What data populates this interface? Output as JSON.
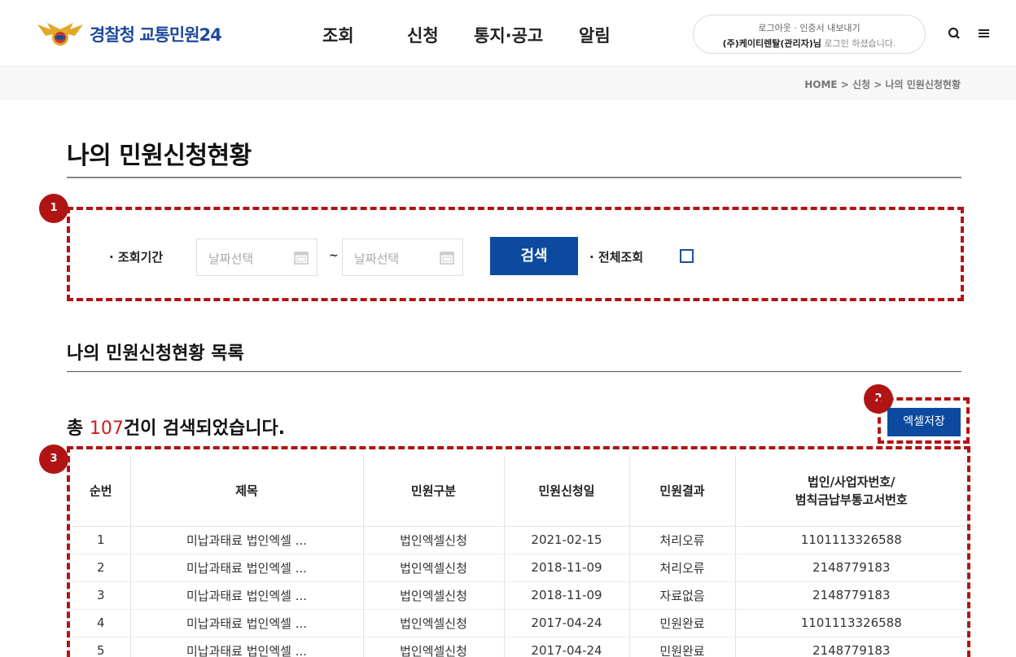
{
  "header": {
    "logo_text": "경찰청 교통민원24",
    "nav": [
      "조회",
      "신청",
      "통지·공고",
      "알림"
    ],
    "login": {
      "line1": "로그아웃 · 인증서 내보내기",
      "user": "(주)케이티렌탈(관리자)님",
      "suffix": "로그인 하셨습니다."
    }
  },
  "breadcrumb": "HOME > 신청 > 나의 민원신청현황",
  "page_title": "나의 민원신청현황",
  "search": {
    "period_label": "· 조회기간",
    "start_placeholder": "날짜선택",
    "tilde": "~",
    "end_placeholder": "날짜선택",
    "search_button": "검색",
    "all_label": "· 전체조회"
  },
  "badges": [
    "1",
    "2",
    "3"
  ],
  "list": {
    "title": "나의 민원신청현황 목록",
    "count_prefix": "총 ",
    "count": "107",
    "count_suffix": "건이 검색되었습니다.",
    "excel_button": "엑셀저장"
  },
  "table": {
    "headers": [
      "순번",
      "제목",
      "민원구분",
      "민원신청일",
      "민원결과",
      "법인/사업자번호/",
      "범칙금납부통고서번호"
    ],
    "rows": [
      [
        "1",
        "미납과태료 법인엑셀 ...",
        "법인엑셀신청",
        "2021-02-15",
        "처리오류",
        "1101113326588"
      ],
      [
        "2",
        "미납과태료 법인엑셀 ...",
        "법인엑셀신청",
        "2018-11-09",
        "처리오류",
        "2148779183"
      ],
      [
        "3",
        "미납과태료 법인엑셀 ...",
        "법인엑셀신청",
        "2018-11-09",
        "자료없음",
        "2148779183"
      ],
      [
        "4",
        "미납과태료 법인엑셀 ...",
        "법인엑셀신청",
        "2017-04-24",
        "민원완료",
        "1101113326588"
      ],
      [
        "5",
        "미납과태료 법인엑셀 ...",
        "법인엑셀신청",
        "2017-04-24",
        "민원완료",
        "2148779183"
      ]
    ]
  },
  "colors": {
    "brand": "#1d4a9b",
    "button": "#0b4a9e",
    "annotation": "#b01414",
    "count": "#d11d1d"
  }
}
